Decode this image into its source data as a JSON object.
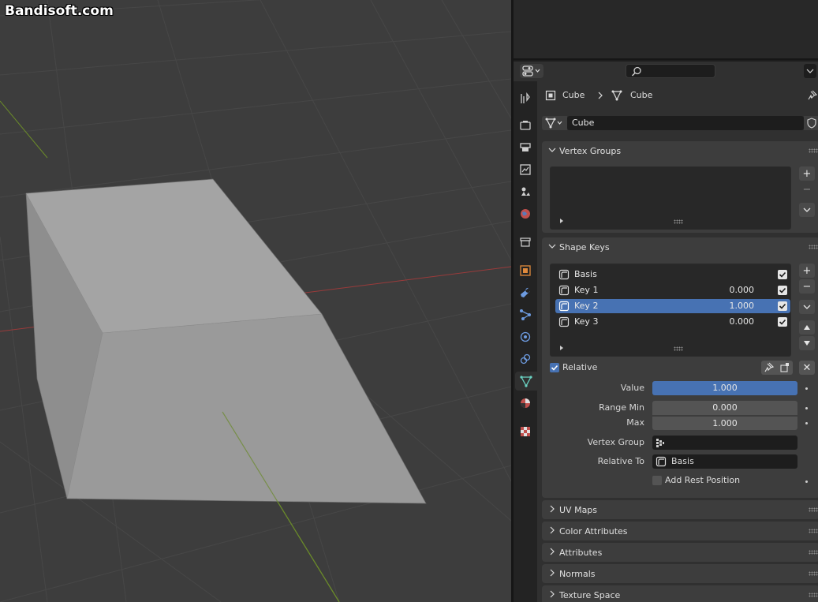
{
  "watermark": "Bandisoft.com",
  "breadcrumb": {
    "object": "Cube",
    "mesh": "Cube"
  },
  "mesh_name": "Cube",
  "panels": {
    "vertex_groups": "Vertex Groups",
    "shape_keys": "Shape Keys",
    "uv_maps": "UV Maps",
    "color_attributes": "Color Attributes",
    "attributes": "Attributes",
    "normals": "Normals",
    "texture_space": "Texture Space"
  },
  "shape_keys": [
    {
      "name": "Basis",
      "value": "",
      "checked": true,
      "selected": false
    },
    {
      "name": "Key 1",
      "value": "0.000",
      "checked": true,
      "selected": false
    },
    {
      "name": "Key 2",
      "value": "1.000",
      "checked": true,
      "selected": true
    },
    {
      "name": "Key 3",
      "value": "0.000",
      "checked": true,
      "selected": false
    }
  ],
  "relative": {
    "label": "Relative",
    "checked": true
  },
  "props": {
    "value_label": "Value",
    "value": "1.000",
    "range_min_label": "Range Min",
    "range_min": "0.000",
    "max_label": "Max",
    "max": "1.000",
    "vertex_group_label": "Vertex Group",
    "vertex_group": "",
    "relative_to_label": "Relative To",
    "relative_to": "Basis",
    "add_rest_label": "Add Rest Position",
    "add_rest_checked": false
  },
  "colors": {
    "accent": "#4772b3",
    "panel": "#3d3d3d",
    "bg": "#303030"
  }
}
